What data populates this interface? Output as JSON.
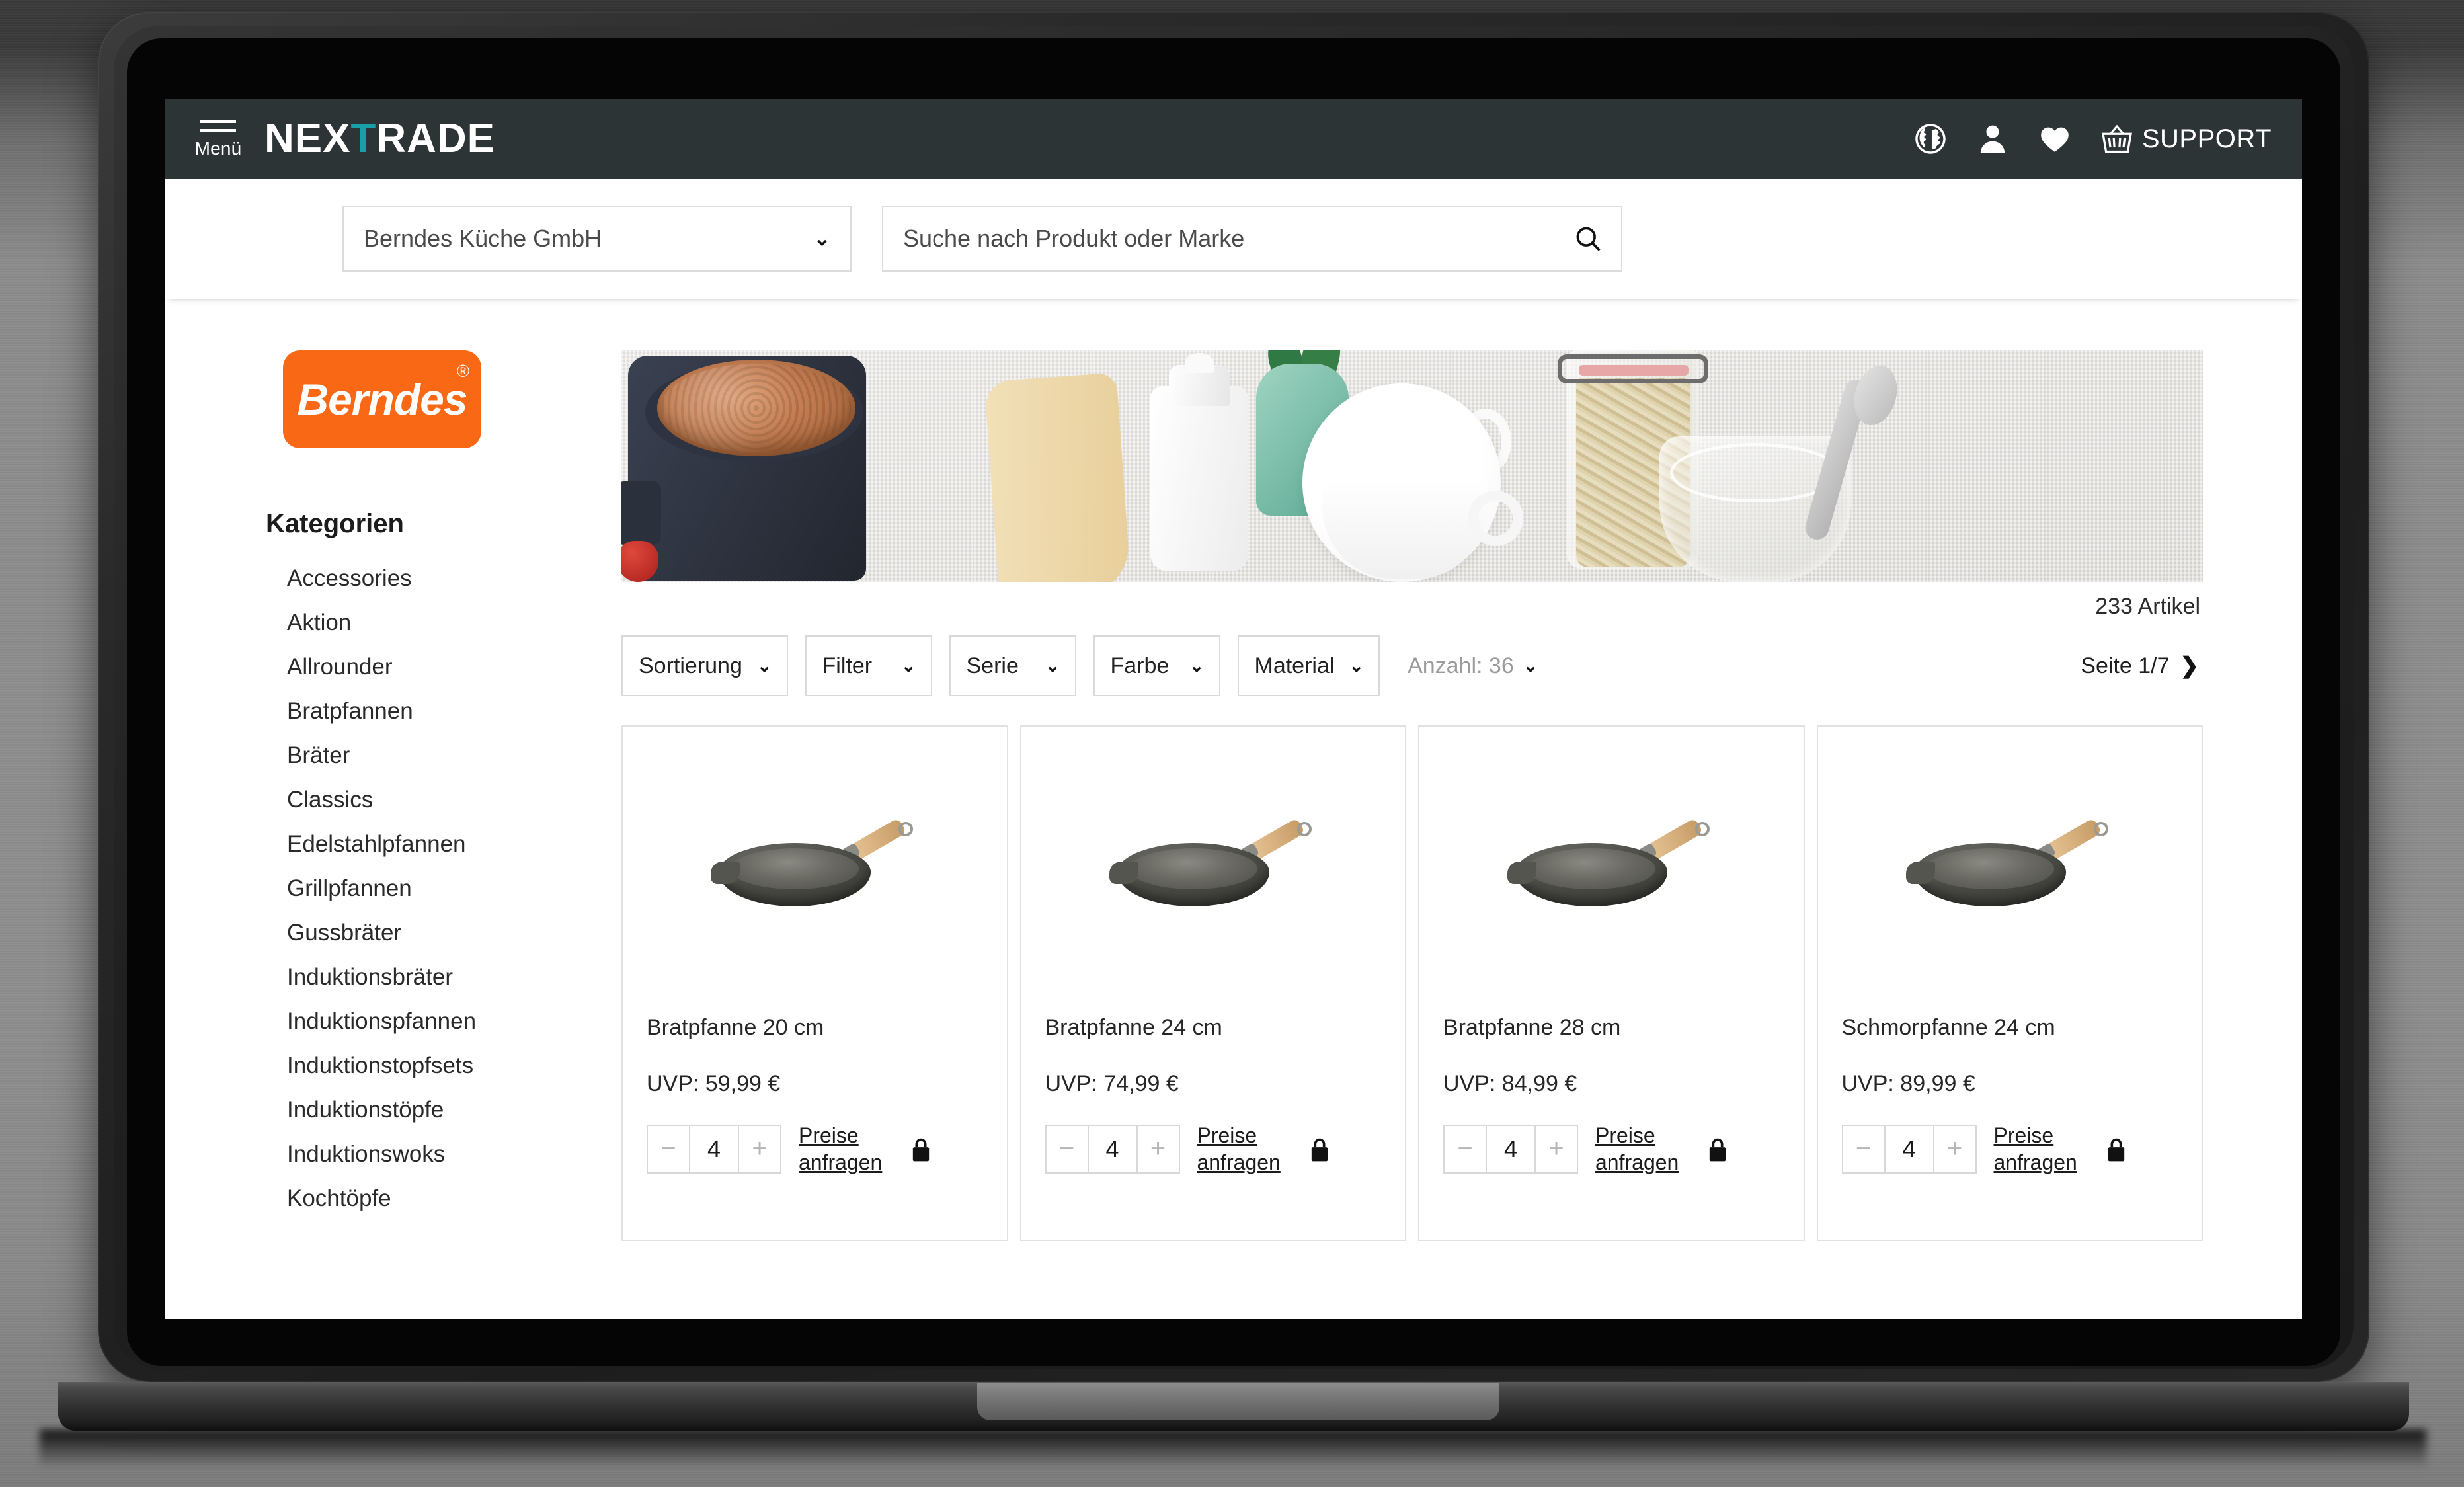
{
  "header": {
    "menu_label": "Menü",
    "brand_prefix": "NEX",
    "brand_accent": "T",
    "brand_suffix": "RADE",
    "support_label": "SUPPORT",
    "icons": [
      "globe-icon",
      "user-icon",
      "heart-icon",
      "basket-icon"
    ],
    "background_color": "#2c3436",
    "accent_color": "#18a0a8"
  },
  "search": {
    "vendor_value": "Berndes Küche GmbH",
    "vendor_chevron": "⌄",
    "placeholder": "Suche nach Produkt oder Marke",
    "search_icon": "search-icon"
  },
  "sidebar": {
    "logo_text": "Berndes",
    "logo_registered": "®",
    "logo_color": "#f96815",
    "categories_title": "Kategorien",
    "categories": [
      "Accessories",
      "Aktion",
      "Allrounder",
      "Bratpfannen",
      "Bräter",
      "Classics",
      "Edelstahlpfannen",
      "Grillpfannen",
      "Gussbräter",
      "Induktionsbräter",
      "Induktionspfannen",
      "Induktionstopfsets",
      "Induktionstöpfe",
      "Induktionswoks",
      "Kochtöpfe"
    ]
  },
  "main": {
    "article_count": "233 Artikel",
    "filters": [
      {
        "label": "Sortierung",
        "chevron": "⌄"
      },
      {
        "label": "Filter",
        "chevron": "⌄"
      },
      {
        "label": "Serie",
        "chevron": "⌄"
      },
      {
        "label": "Farbe",
        "chevron": "⌄"
      },
      {
        "label": "Material",
        "chevron": "⌄"
      }
    ],
    "amount_label": "Anzahl: 36",
    "amount_chevron": "⌄",
    "page_label": "Seite 1/7",
    "page_arrow": "❯",
    "products": [
      {
        "title": "Bratpfanne 20 cm",
        "price": "UVP: 59,99 €",
        "quantity": "4",
        "minus": "−",
        "plus": "+",
        "ask_label": "Preise anfragen",
        "lock_icon": "lock-icon"
      },
      {
        "title": "Bratpfanne 24 cm",
        "price": "UVP: 74,99 €",
        "quantity": "4",
        "minus": "−",
        "plus": "+",
        "ask_label": "Preise anfragen",
        "lock_icon": "lock-icon"
      },
      {
        "title": "Bratpfanne 28 cm",
        "price": "UVP: 84,99 €",
        "quantity": "4",
        "minus": "−",
        "plus": "+",
        "ask_label": "Preise anfragen",
        "lock_icon": "lock-icon"
      },
      {
        "title": "Schmorpfanne 24 cm",
        "price": "UVP: 89,99 €",
        "quantity": "4",
        "minus": "−",
        "plus": "+",
        "ask_label": "Preise anfragen",
        "lock_icon": "lock-icon"
      }
    ]
  }
}
